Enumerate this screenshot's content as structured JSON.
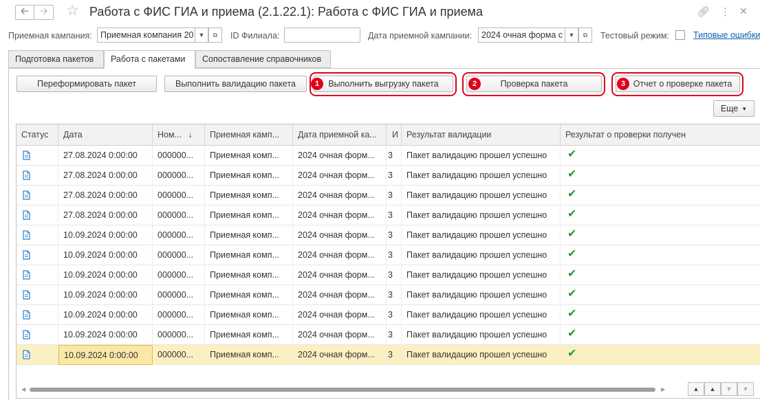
{
  "window": {
    "title": "Работа с ФИС ГИА и приема (2.1.22.1): Работа с ФИС ГИА и приема"
  },
  "filters": {
    "campaign_label": "Приемная кампания:",
    "campaign_value": "Приемная компания 20",
    "branch_label": "ID Филиала:",
    "branch_value": "",
    "date_label": "Дата приемной кампании:",
    "date_value": "2024 очная форма с",
    "test_label": "Тестовый режим:",
    "errors_link": "Типовые ошибки"
  },
  "tabs": [
    {
      "label": "Подготовка пакетов"
    },
    {
      "label": "Работа с пакетами"
    },
    {
      "label": "Сопоставление справочников"
    }
  ],
  "toolbar": {
    "reform_label": "Переформировать пакет",
    "validate_label": "Выполнить валидацию пакета",
    "upload_label": "Выполнить выгрузку пакета",
    "check_label": "Проверка пакета",
    "report_label": "Отчет о проверке пакета",
    "more_label": "Еще",
    "badges": [
      "1",
      "2",
      "3"
    ]
  },
  "table": {
    "columns": [
      "Статус",
      "Дата",
      "Ном...",
      "Приемная камп...",
      "Дата приемной ка...",
      "И",
      "Результат валидации",
      "Результат о проверки получен"
    ],
    "rows": [
      {
        "date": "27.08.2024 0:00:00",
        "num": "000000...",
        "campaign": "Приемная комп...",
        "cdate": "2024 очная форм...",
        "id": "3",
        "result": "Пакет валидацию прошел успешно"
      },
      {
        "date": "27.08.2024 0:00:00",
        "num": "000000...",
        "campaign": "Приемная комп...",
        "cdate": "2024 очная форм...",
        "id": "3",
        "result": "Пакет валидацию прошел успешно"
      },
      {
        "date": "27.08.2024 0:00:00",
        "num": "000000...",
        "campaign": "Приемная комп...",
        "cdate": "2024 очная форм...",
        "id": "3",
        "result": "Пакет валидацию прошел успешно"
      },
      {
        "date": "27.08.2024 0:00:00",
        "num": "000000...",
        "campaign": "Приемная комп...",
        "cdate": "2024 очная форм...",
        "id": "3",
        "result": "Пакет валидацию прошел успешно"
      },
      {
        "date": "10.09.2024 0:00:00",
        "num": "000000...",
        "campaign": "Приемная комп...",
        "cdate": "2024 очная форм...",
        "id": "3",
        "result": "Пакет валидацию прошел успешно"
      },
      {
        "date": "10.09.2024 0:00:00",
        "num": "000000...",
        "campaign": "Приемная комп...",
        "cdate": "2024 очная форм...",
        "id": "3",
        "result": "Пакет валидацию прошел успешно"
      },
      {
        "date": "10.09.2024 0:00:00",
        "num": "000000...",
        "campaign": "Приемная комп...",
        "cdate": "2024 очная форм...",
        "id": "3",
        "result": "Пакет валидацию прошел успешно"
      },
      {
        "date": "10.09.2024 0:00:00",
        "num": "000000...",
        "campaign": "Приемная комп...",
        "cdate": "2024 очная форм...",
        "id": "3",
        "result": "Пакет валидацию прошел успешно"
      },
      {
        "date": "10.09.2024 0:00:00",
        "num": "000000...",
        "campaign": "Приемная комп...",
        "cdate": "2024 очная форм...",
        "id": "3",
        "result": "Пакет валидацию прошел успешно"
      },
      {
        "date": "10.09.2024 0:00:00",
        "num": "000000...",
        "campaign": "Приемная комп...",
        "cdate": "2024 очная форм...",
        "id": "3",
        "result": "Пакет валидацию прошел успешно"
      },
      {
        "date": "10.09.2024 0:00:00",
        "num": "000000...",
        "campaign": "Приемная комп...",
        "cdate": "2024 очная форм...",
        "id": "3",
        "result": "Пакет валидацию прошел успешно"
      }
    ]
  },
  "icons": {
    "status_icon": "document-icon",
    "result_icon": "checkmark-icon",
    "sort_icon": "sort-desc-icon"
  },
  "colors": {
    "highlight": "#e0001a",
    "selected_row": "#fbf0c2",
    "check": "#1e9a3a",
    "link": "#0b5eb0"
  }
}
